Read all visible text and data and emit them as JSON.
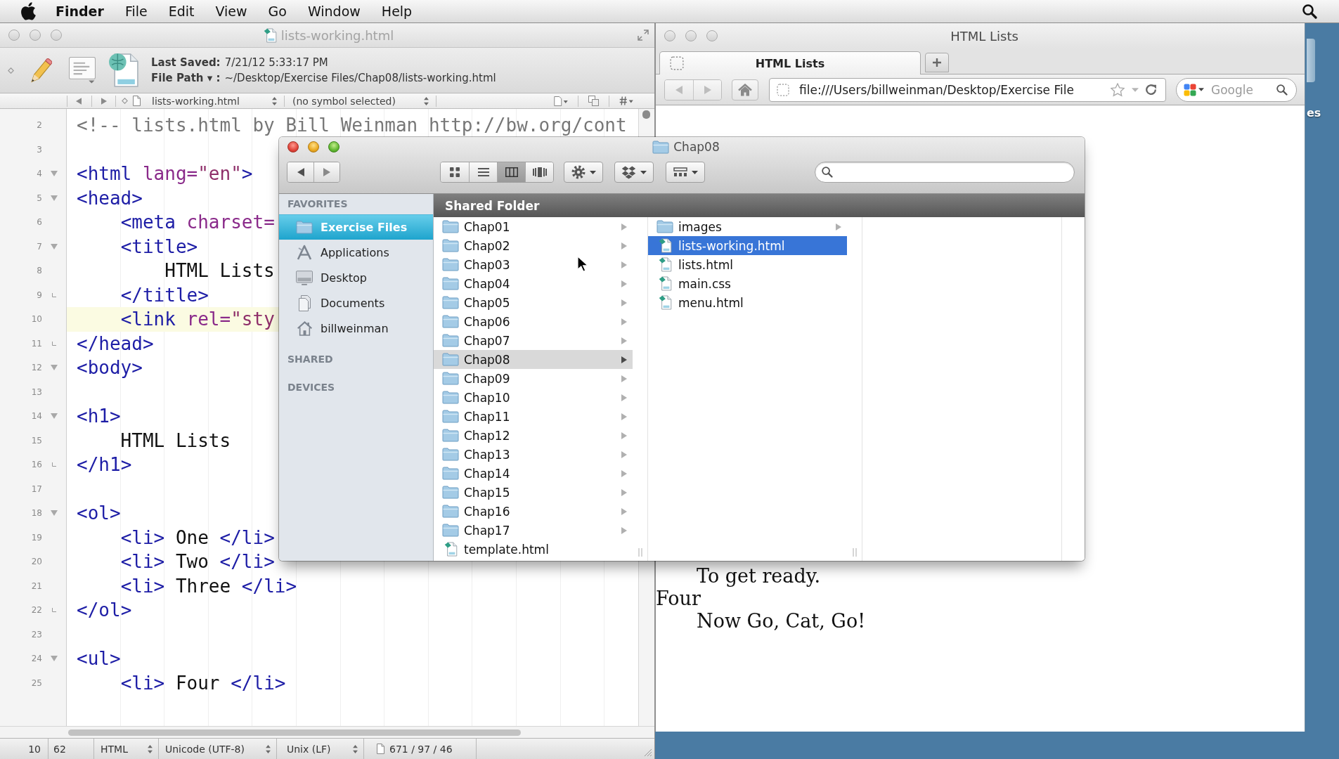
{
  "menu_bar": {
    "app_name": "Finder",
    "items": [
      "File",
      "Edit",
      "View",
      "Go",
      "Window",
      "Help"
    ]
  },
  "editor": {
    "title": "lists-working.html",
    "last_saved_label": "Last Saved:",
    "last_saved": "7/21/12 5:33:17 PM",
    "file_path_label": "File Path ▾ :",
    "file_path": "~/Desktop/Exercise Files/Chap08/lists-working.html",
    "file_popup": "lists-working.html",
    "symbol_popup": "(no symbol selected)",
    "lines": [
      {
        "number": "2",
        "text": "<!-- lists.html by Bill Weinman http://bw.org/cont",
        "fold_start": false,
        "fold_end": false,
        "highlighted": false
      },
      {
        "number": "3",
        "fold_start": false,
        "fold_end": false,
        "highlighted": false
      },
      {
        "number": "4",
        "text": "<html lang=\"en\">",
        "fold_start": true,
        "fold_end": false,
        "highlighted": false
      },
      {
        "number": "5",
        "text": "<head>",
        "fold_start": true,
        "fold_end": false,
        "highlighted": false
      },
      {
        "number": "6",
        "text": "    <meta charset=",
        "fold_start": false,
        "fold_end": false,
        "highlighted": false
      },
      {
        "number": "7",
        "text": "    <title>",
        "fold_start": true,
        "fold_end": false,
        "highlighted": false
      },
      {
        "number": "8",
        "text": "        HTML Lists",
        "fold_start": false,
        "fold_end": false,
        "highlighted": false
      },
      {
        "number": "9",
        "text": "    </title>",
        "fold_start": false,
        "fold_end": true,
        "highlighted": false
      },
      {
        "number": "10",
        "text": "    <link rel=\"sty",
        "fold_start": false,
        "fold_end": false,
        "highlighted": true
      },
      {
        "number": "11",
        "text": "</head>",
        "fold_start": false,
        "fold_end": true,
        "highlighted": false
      },
      {
        "number": "12",
        "text": "<body>",
        "fold_start": true,
        "fold_end": false,
        "highlighted": false
      },
      {
        "number": "13",
        "fold_start": false,
        "fold_end": false,
        "highlighted": false
      },
      {
        "number": "14",
        "text": "<h1>",
        "fold_start": true,
        "fold_end": false,
        "highlighted": false
      },
      {
        "number": "15",
        "text": "    HTML Lists",
        "fold_start": false,
        "fold_end": false,
        "highlighted": false
      },
      {
        "number": "16",
        "text": "</h1>",
        "fold_start": false,
        "fold_end": true,
        "highlighted": false
      },
      {
        "number": "17",
        "fold_start": false,
        "fold_end": false,
        "highlighted": false
      },
      {
        "number": "18",
        "text": "<ol>",
        "fold_start": true,
        "fold_end": false,
        "highlighted": false
      },
      {
        "number": "19",
        "text": "    <li> One </li>",
        "fold_start": false,
        "fold_end": false,
        "highlighted": false
      },
      {
        "number": "20",
        "text": "    <li> Two </li>",
        "fold_start": false,
        "fold_end": false,
        "highlighted": false
      },
      {
        "number": "21",
        "text": "    <li> Three </li>",
        "fold_start": false,
        "fold_end": false,
        "highlighted": false
      },
      {
        "number": "22",
        "text": "</ol>",
        "fold_start": false,
        "fold_end": true,
        "highlighted": false
      },
      {
        "number": "23",
        "fold_start": false,
        "fold_end": false,
        "highlighted": false
      },
      {
        "number": "24",
        "text": "<ul>",
        "fold_start": true,
        "fold_end": false,
        "highlighted": false
      },
      {
        "number": "25",
        "text": "    <li> Four </li>",
        "fold_start": false,
        "fold_end": false,
        "highlighted": false
      }
    ],
    "status_bar": {
      "line": "10",
      "column": "62",
      "language": "HTML",
      "encoding": "Unicode (UTF-8)",
      "line_endings": "Unix (LF)",
      "document_stats": "671 / 97 / 46"
    }
  },
  "finder": {
    "title": "Chap08",
    "view_buttons": [
      {
        "kind": "icons",
        "selected": false
      },
      {
        "kind": "list",
        "selected": false
      },
      {
        "kind": "columns",
        "selected": true
      },
      {
        "kind": "cover_flow",
        "selected": false
      }
    ],
    "sidebar": [
      {
        "heading": "FAVORITES",
        "items": [
          {
            "label": "Exercise Files",
            "kind": "folder",
            "selected": true
          },
          {
            "label": "Applications",
            "kind": "applications",
            "selected": false
          },
          {
            "label": "Desktop",
            "kind": "desktop",
            "selected": false
          },
          {
            "label": "Documents",
            "kind": "documents",
            "selected": false
          },
          {
            "label": "billweinman",
            "kind": "home",
            "selected": false
          }
        ]
      },
      {
        "heading": "SHARED"
      },
      {
        "heading": "DEVICES"
      }
    ],
    "path_header": "Shared Folder",
    "columns": [
      {
        "focused": false,
        "items": [
          {
            "name": "Chap01",
            "kind": "folder",
            "selected": false
          },
          {
            "name": "Chap02",
            "kind": "folder",
            "selected": false
          },
          {
            "name": "Chap03",
            "kind": "folder",
            "selected": false
          },
          {
            "name": "Chap04",
            "kind": "folder",
            "selected": false
          },
          {
            "name": "Chap05",
            "kind": "folder",
            "selected": false
          },
          {
            "name": "Chap06",
            "kind": "folder",
            "selected": false
          },
          {
            "name": "Chap07",
            "kind": "folder",
            "selected": false
          },
          {
            "name": "Chap08",
            "kind": "folder",
            "selected": true
          },
          {
            "name": "Chap09",
            "kind": "folder",
            "selected": false
          },
          {
            "name": "Chap10",
            "kind": "folder",
            "selected": false
          },
          {
            "name": "Chap11",
            "kind": "folder",
            "selected": false
          },
          {
            "name": "Chap12",
            "kind": "folder",
            "selected": false
          },
          {
            "name": "Chap13",
            "kind": "folder",
            "selected": false
          },
          {
            "name": "Chap14",
            "kind": "folder",
            "selected": false
          },
          {
            "name": "Chap15",
            "kind": "folder",
            "selected": false
          },
          {
            "name": "Chap16",
            "kind": "folder",
            "selected": false
          },
          {
            "name": "Chap17",
            "kind": "folder",
            "selected": false
          },
          {
            "name": "template.html",
            "kind": "file",
            "selected": false
          }
        ]
      },
      {
        "focused": true,
        "items": [
          {
            "name": "images",
            "kind": "folder",
            "selected": false
          },
          {
            "name": "lists-working.html",
            "kind": "file",
            "selected": true
          },
          {
            "name": "lists.html",
            "kind": "file",
            "selected": false
          },
          {
            "name": "main.css",
            "kind": "file",
            "selected": false
          },
          {
            "name": "menu.html",
            "kind": "file",
            "selected": false
          }
        ]
      }
    ]
  },
  "browser": {
    "title": "HTML Lists",
    "tabs": [
      {
        "label": "HTML Lists",
        "selected": true
      }
    ],
    "url": "file:///Users/billweinman/Desktop/Exercise File",
    "search_placeholder": "Google",
    "content": [
      {
        "kind": "indented",
        "text": "To get ready."
      },
      {
        "kind": "plain",
        "text": "Four"
      },
      {
        "kind": "indented",
        "text": "Now Go, Cat, Go!"
      }
    ]
  },
  "desktop": {
    "icon_label": "es"
  }
}
